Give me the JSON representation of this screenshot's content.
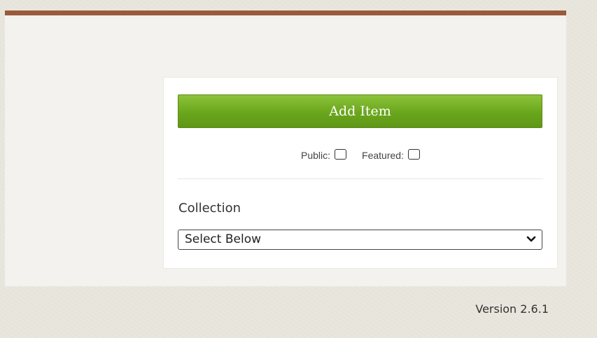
{
  "save_panel": {
    "add_item_label": "Add Item",
    "public_label": "Public:",
    "public_checked": false,
    "featured_label": "Featured:",
    "featured_checked": false
  },
  "collection": {
    "label": "Collection",
    "selected_value": "Select Below",
    "chevron_icon": "chevron-down-icon"
  },
  "footer": {
    "version": "Version 2.6.1"
  },
  "colors": {
    "accent_rule": "#9a5a3c",
    "button_green": "#6aa61d"
  }
}
